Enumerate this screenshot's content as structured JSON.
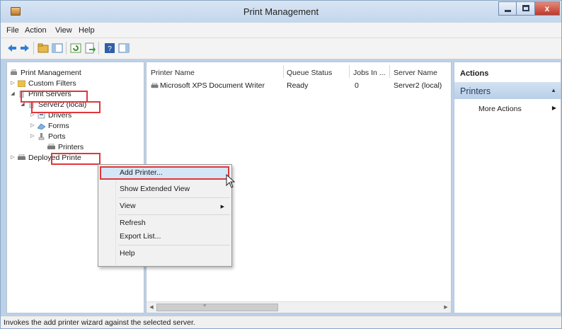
{
  "window": {
    "title": "Print Management",
    "close_glyph": "x"
  },
  "menu": [
    "File",
    "Action",
    "View",
    "Help"
  ],
  "toolbar_icons": [
    "back-arrow-icon",
    "forward-arrow-icon",
    "up-folder-icon",
    "show-hide-tree-icon",
    "refresh-icon",
    "export-list-icon",
    "help-icon",
    "show-hide-action-pane-icon"
  ],
  "tree": {
    "root": "Print Management",
    "custom_filters": "Custom Filters",
    "print_servers": "Print Servers",
    "server": "Server2 (local)",
    "drivers": "Drivers",
    "forms": "Forms",
    "ports": "Ports",
    "printers": "Printers",
    "deployed": "Deployed Printe"
  },
  "list": {
    "columns": [
      "Printer Name",
      "Queue Status",
      "Jobs In ...",
      "Server Name"
    ],
    "rows": [
      {
        "name": "Microsoft XPS Document Writer",
        "status": "Ready",
        "jobs": "0",
        "server": "Server2 (local)"
      }
    ],
    "scroll_grip": "≡"
  },
  "actions": {
    "header": "Actions",
    "section": "Printers",
    "more": "More Actions"
  },
  "context_menu": {
    "add_printer": "Add Printer...",
    "show_extended": "Show Extended View",
    "view": "View",
    "refresh": "Refresh",
    "export": "Export List...",
    "help": "Help"
  },
  "status": "Invokes the add printer wizard against the selected server.",
  "colors": {
    "highlight_box": "#e0373a",
    "section_band": "#b8cfe7",
    "window_frame": "#bcd1e8"
  }
}
